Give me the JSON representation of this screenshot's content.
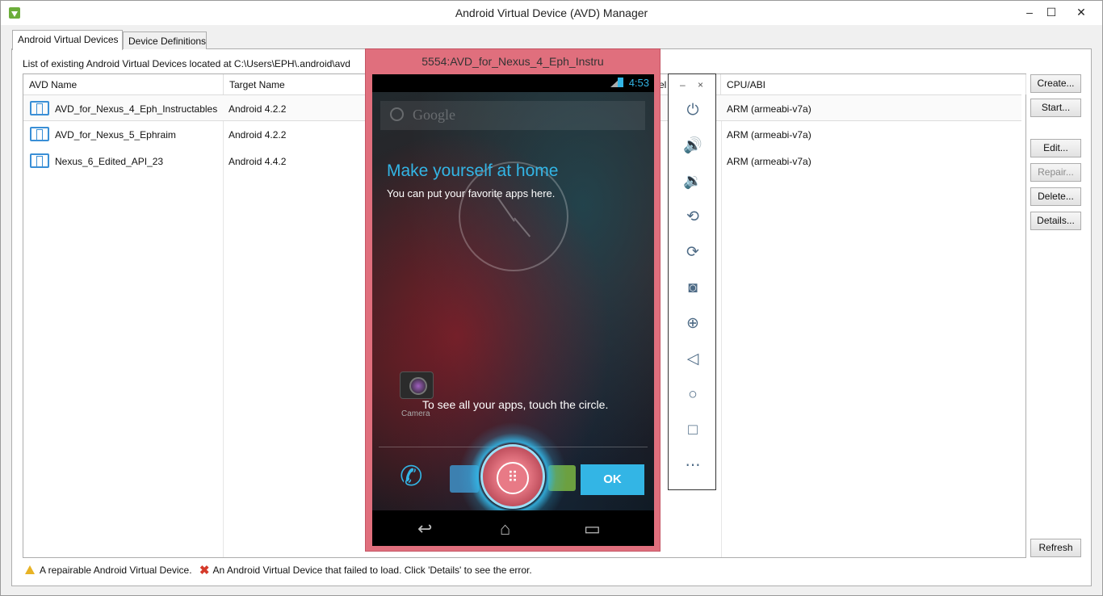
{
  "window": {
    "title": "Android Virtual Device (AVD) Manager",
    "minimize": "–",
    "maximize": "☐",
    "close": "✕"
  },
  "tabs": [
    {
      "label": "Android Virtual Devices",
      "active": true
    },
    {
      "label": "Device Definitions",
      "active": false
    }
  ],
  "caption": "List of existing Android Virtual Devices located at C:\\Users\\EPH\\.android\\avd",
  "table": {
    "headers": {
      "avd_name": "AVD Name",
      "target_name": "Target Name",
      "api_partial": "el",
      "cpu_abi": "CPU/ABI"
    },
    "rows": [
      {
        "avd_name": "AVD_for_Nexus_4_Eph_Instructables",
        "target": "Android 4.2.2",
        "cpu": "ARM (armeabi-v7a)",
        "selected": true
      },
      {
        "avd_name": "AVD_for_Nexus_5_Ephraim",
        "target": "Android 4.2.2",
        "cpu": "ARM (armeabi-v7a)",
        "selected": false
      },
      {
        "avd_name": "Nexus_6_Edited_API_23",
        "target": "Android 4.4.2",
        "cpu": "ARM (armeabi-v7a)",
        "selected": false
      }
    ]
  },
  "buttons": {
    "create": "Create...",
    "start": "Start...",
    "edit": "Edit...",
    "repair": "Repair...",
    "delete": "Delete...",
    "details": "Details...",
    "refresh": "Refresh"
  },
  "legend": {
    "repairable": "A repairable Android Virtual Device.",
    "failed": "An Android Virtual Device that failed to load. Click 'Details' to see the error."
  },
  "emulator": {
    "title": "5554:AVD_for_Nexus_4_Eph_Instru",
    "clock": "4:53",
    "search_placeholder": "Google",
    "home_title": "Make yourself at home",
    "home_sub": "You can put your favorite apps here.",
    "camera_label": "Camera",
    "tip": "To see all your apps, touch the circle.",
    "ok": "OK",
    "side_minimize": "–",
    "side_close": "×",
    "tools": [
      "power-icon",
      "volume-up-icon",
      "volume-down-icon",
      "rotate-left-icon",
      "rotate-right-icon",
      "camera-icon",
      "zoom-icon",
      "back-icon",
      "home-icon",
      "overview-icon",
      "more-icon"
    ]
  },
  "colors": {
    "accent": "#33b5e5",
    "emulator_frame": "#e06f7d",
    "warning": "#e8b325",
    "error": "#d53a2a"
  }
}
